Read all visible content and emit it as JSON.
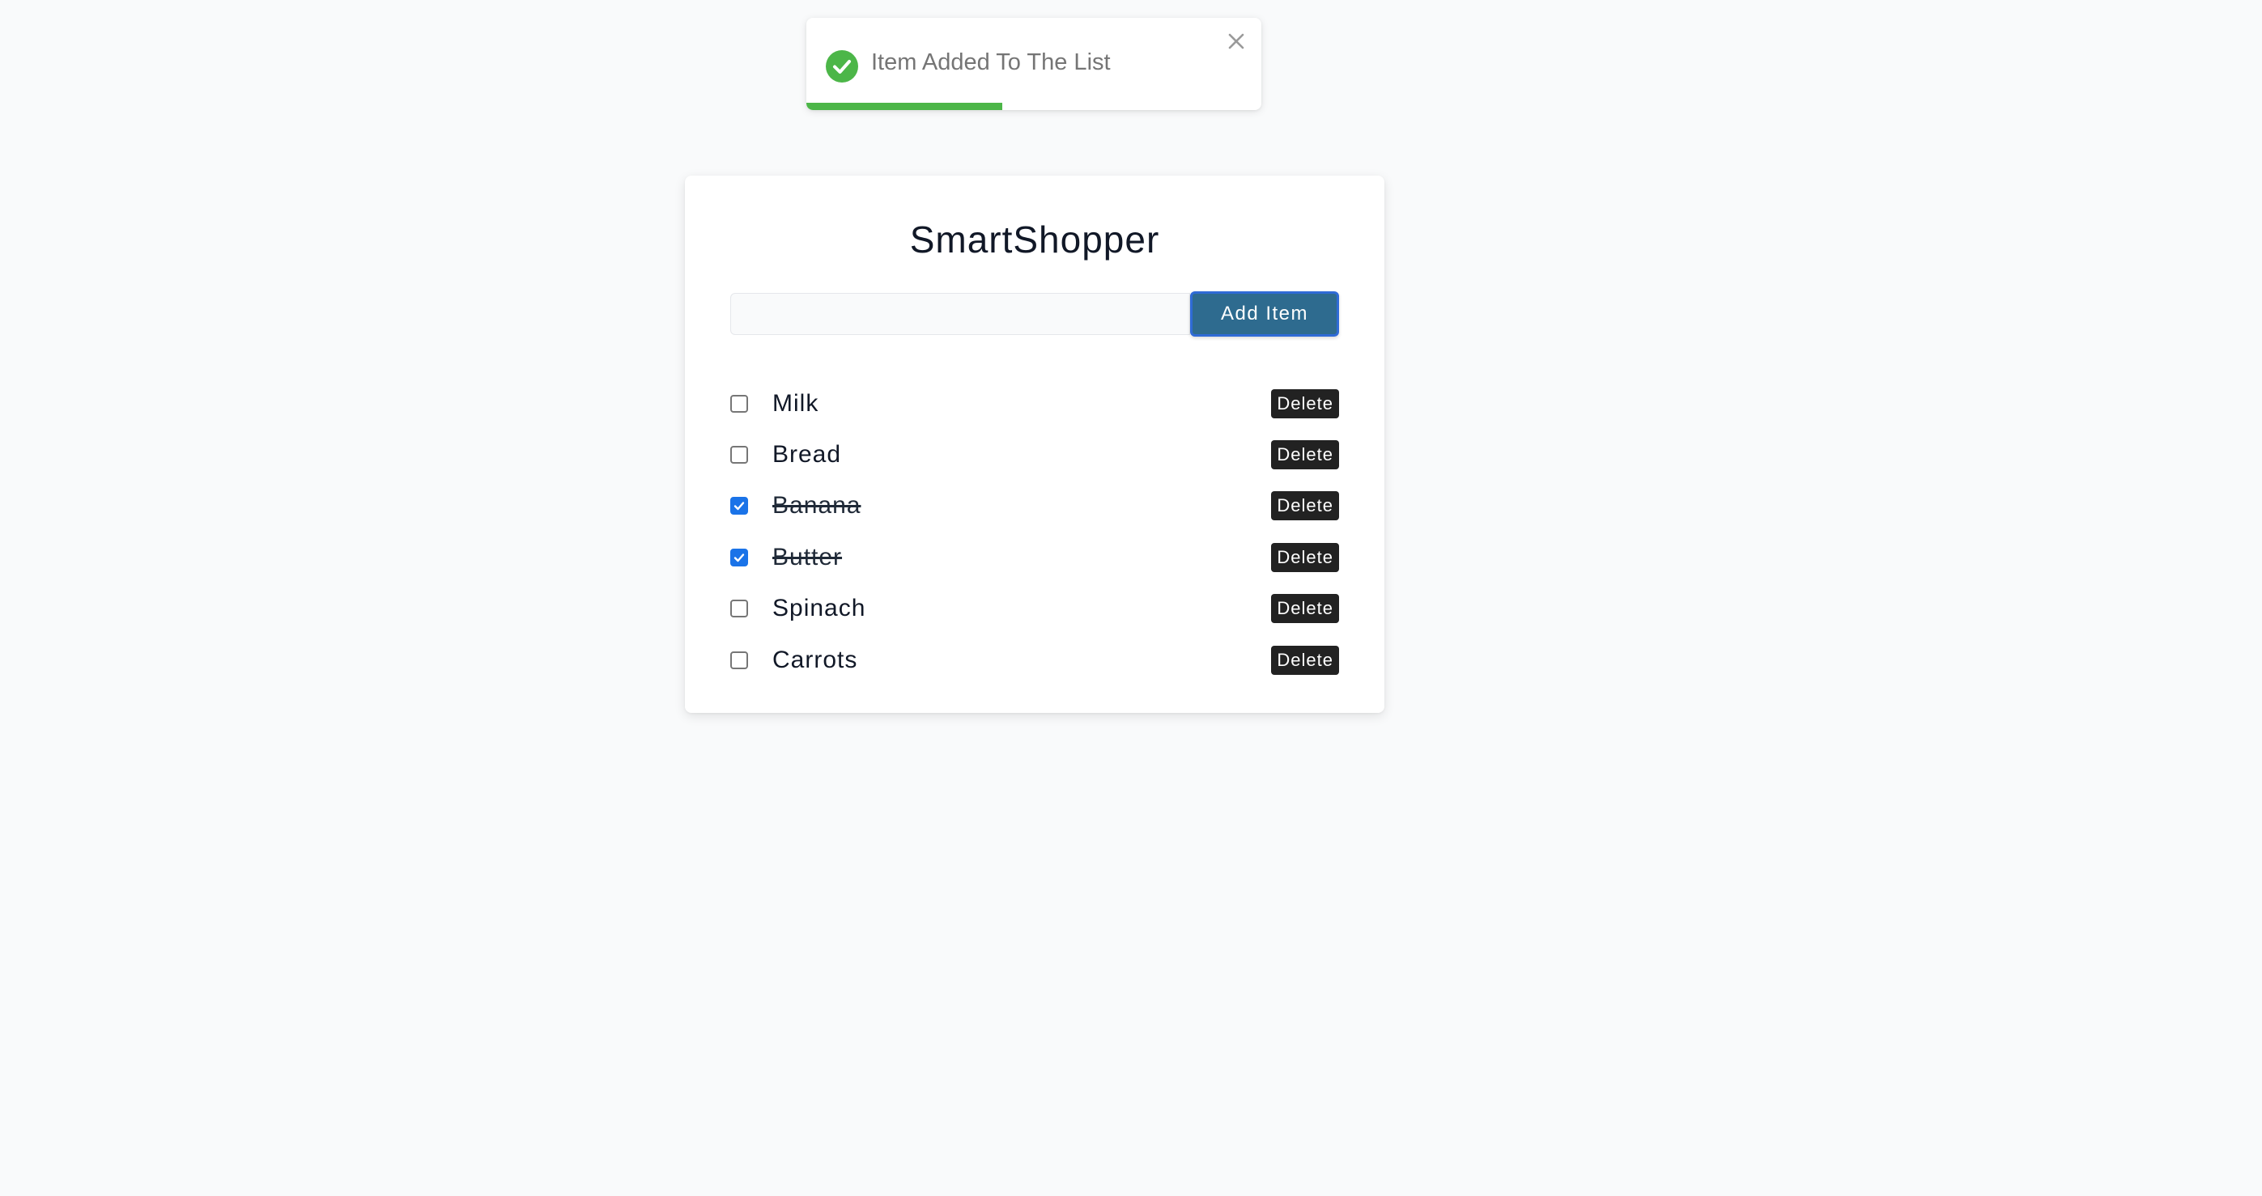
{
  "toast": {
    "icon": "check-circle-icon",
    "message": "Item Added To The List",
    "close_icon": "close-icon",
    "progress": 0.43,
    "accent_color": "#4cb648"
  },
  "app": {
    "title": "SmartShopper"
  },
  "add_form": {
    "input_value": "",
    "input_placeholder": "",
    "button_label": "Add Item",
    "button_color": "#2e6b8f"
  },
  "items": [
    {
      "label": "Milk",
      "checked": false,
      "delete_label": "Delete"
    },
    {
      "label": "Bread",
      "checked": false,
      "delete_label": "Delete"
    },
    {
      "label": "Banana",
      "checked": true,
      "delete_label": "Delete"
    },
    {
      "label": "Butter",
      "checked": true,
      "delete_label": "Delete"
    },
    {
      "label": "Spinach",
      "checked": false,
      "delete_label": "Delete"
    },
    {
      "label": "Carrots",
      "checked": false,
      "delete_label": "Delete"
    }
  ]
}
